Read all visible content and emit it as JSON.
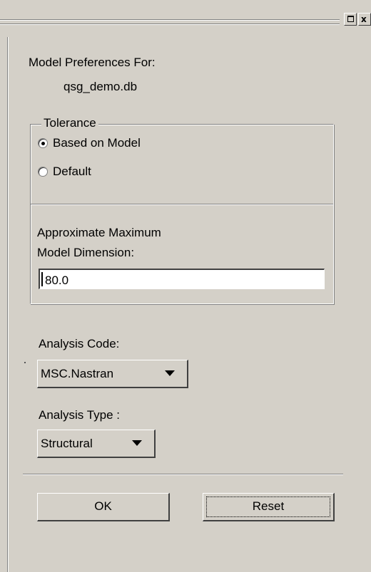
{
  "window": {
    "title_buttons": {
      "maximize_icon": "maximize-icon",
      "close_icon": "close-icon",
      "close_glyph": "x"
    }
  },
  "model_preferences": {
    "label": "Model Preferences For:",
    "database": "qsg_demo.db"
  },
  "tolerance": {
    "group_label": "Tolerance",
    "options": [
      {
        "label": "Based on Model",
        "selected": true
      },
      {
        "label": "Default",
        "selected": false
      }
    ],
    "dimension_label_line1": "Approximate Maximum",
    "dimension_label_line2": "Model Dimension:",
    "dimension_value": "80.0"
  },
  "analysis_code": {
    "label": "Analysis Code:",
    "selected": "MSC.Nastran"
  },
  "analysis_type": {
    "label": "Analysis Type :",
    "selected": "Structural"
  },
  "actions": {
    "ok_label": "OK",
    "reset_label": "Reset"
  },
  "colors": {
    "panel_bg": "#d4d0c8",
    "shadow": "#808080",
    "highlight": "#ffffff"
  }
}
